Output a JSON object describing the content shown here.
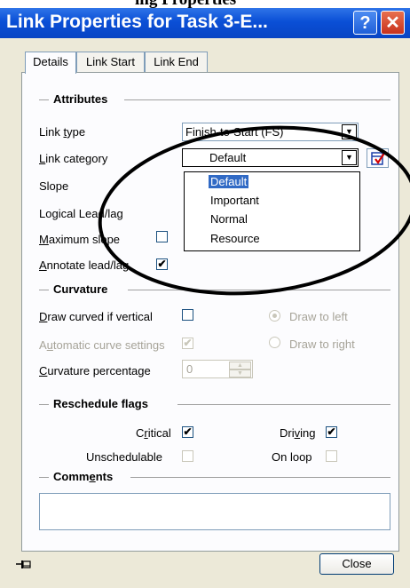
{
  "top_text": "ing Properties",
  "title": "Link Properties for Task 3-E...",
  "title_buttons": {
    "help": "?",
    "close": "✕"
  },
  "tabs": [
    "Details",
    "Link Start",
    "Link End"
  ],
  "sections": {
    "attributes": "Attributes",
    "curvature": "Curvature",
    "reschedule": "Reschedule flags",
    "comments": "Comments"
  },
  "attributes": {
    "link_type_label": "Link type",
    "link_type_value": "Finish-to-Start (FS)",
    "link_category_label": "Link category",
    "link_category_value": "Default",
    "category_options": [
      "Default",
      "Important",
      "Normal",
      "Resource"
    ],
    "slope_label": "Slope",
    "lead_lag_label": "Logical Lead/lag",
    "max_slope_label": "Maximum slope",
    "max_slope_checked": false,
    "annotate_label": "Annotate lead/lag",
    "annotate_checked": true
  },
  "curvature": {
    "draw_curved_label": "Draw curved if vertical",
    "draw_curved_checked": false,
    "auto_label": "Automatic curve settings",
    "auto_checked": true,
    "percentage_label": "Curvature percentage",
    "percentage_value": "0",
    "draw_left_label": "Draw to left",
    "draw_right_label": "Draw to right"
  },
  "reschedule": {
    "critical_label": "Critical",
    "critical_checked": true,
    "driving_label": "Driving",
    "driving_checked": true,
    "unschedulable_label": "Unschedulable",
    "unschedulable_checked": false,
    "on_loop_label": "On loop",
    "on_loop_checked": false
  },
  "comments_value": "",
  "close_button": "Close",
  "check_mark": "✔",
  "pin_icon": "pushpin-icon",
  "colors": {
    "title_bar": "#0a4fd6",
    "selection": "#316ac5"
  }
}
